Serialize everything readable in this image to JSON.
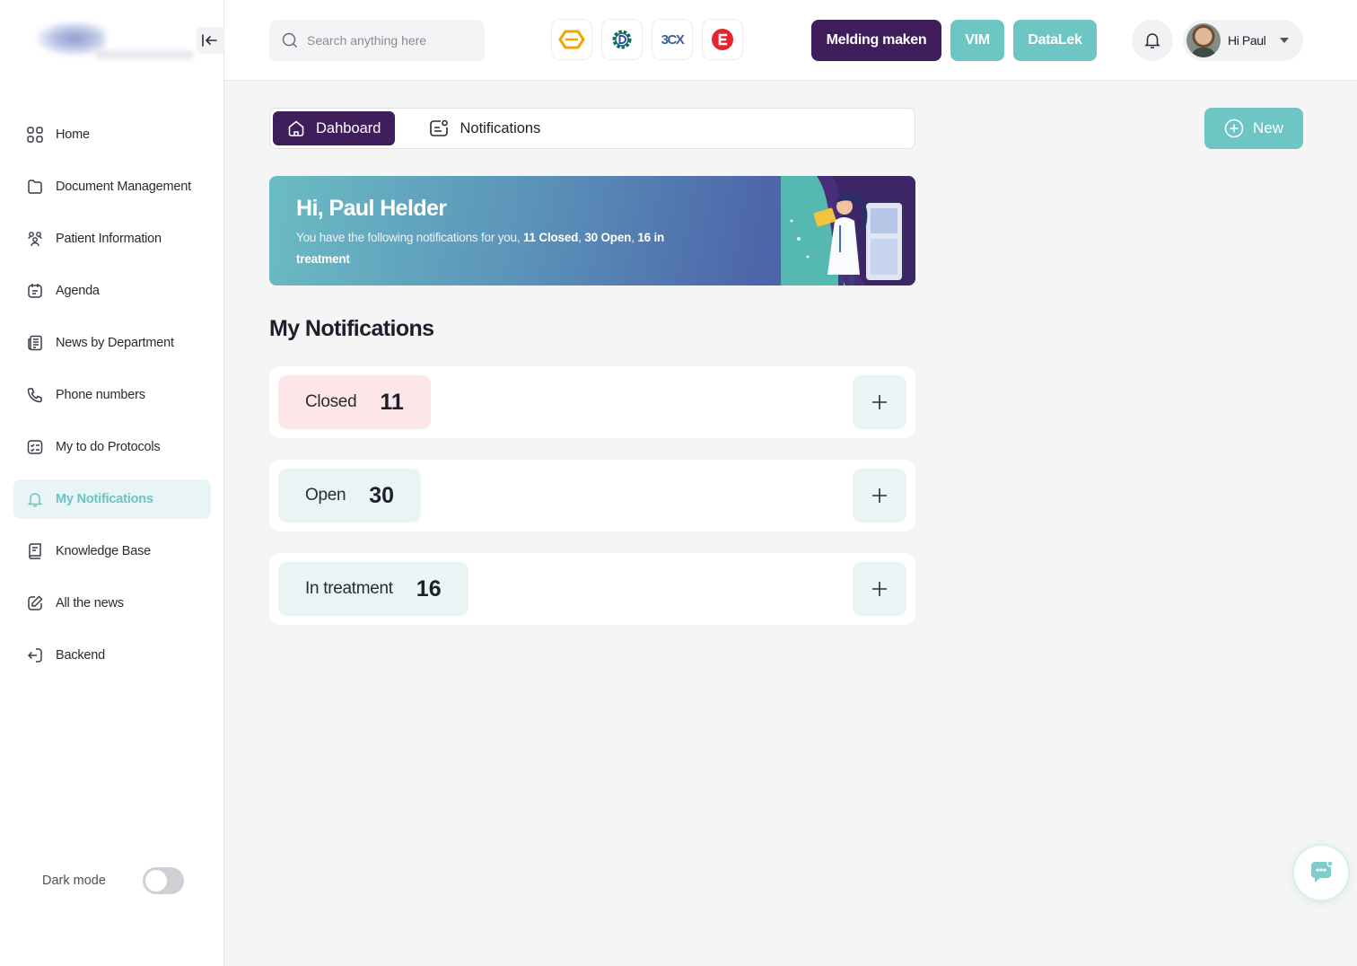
{
  "sidebar": {
    "items": [
      {
        "label": "Home",
        "icon": "grid-icon"
      },
      {
        "label": "Document Management",
        "icon": "folder-icon"
      },
      {
        "label": "Patient Information",
        "icon": "people-icon"
      },
      {
        "label": "Agenda",
        "icon": "calendar-icon"
      },
      {
        "label": "News by Department",
        "icon": "newspaper-icon"
      },
      {
        "label": "Phone numbers",
        "icon": "phone-icon"
      },
      {
        "label": "My to do Protocols",
        "icon": "checklist-icon"
      },
      {
        "label": "My Notifications",
        "icon": "bell-icon",
        "active": true
      },
      {
        "label": "Knowledge Base",
        "icon": "book-icon"
      },
      {
        "label": "All the news",
        "icon": "edit-icon"
      },
      {
        "label": "Backend",
        "icon": "logout-icon"
      }
    ],
    "dark_mode_label": "Dark mode",
    "dark_mode_on": false
  },
  "header": {
    "search_placeholder": "Search anything here",
    "app_icons": [
      "hexagon-app-icon",
      "d-gear-app-icon",
      "3cx-app-icon",
      "e-app-icon"
    ],
    "app_3cx_text": "3CX",
    "buttons": {
      "melding": "Melding maken",
      "vim": "VIM",
      "datalek": "DataLek"
    },
    "profile_name": "Hi Paul"
  },
  "tabs": [
    {
      "label": "Dahboard",
      "active": true
    },
    {
      "label": "Notifications",
      "active": false
    }
  ],
  "new_button": "New",
  "banner": {
    "greeting": "Hi, Paul Helder",
    "text_prefix": "You have the following notifications  for you, ",
    "closed": "11 Closed",
    "open": "30 Open",
    "treatment": "16 in treatment"
  },
  "section_title": "My Notifications",
  "notifications": [
    {
      "label": "Closed",
      "count": "11"
    },
    {
      "label": "Open",
      "count": "30"
    },
    {
      "label": "In treatment",
      "count": "16"
    }
  ],
  "colors": {
    "primary": "#3e1f5c",
    "accent": "#6ec6c4",
    "closed_bg": "#fde6e7",
    "teal_bg": "#e9f4f5"
  }
}
